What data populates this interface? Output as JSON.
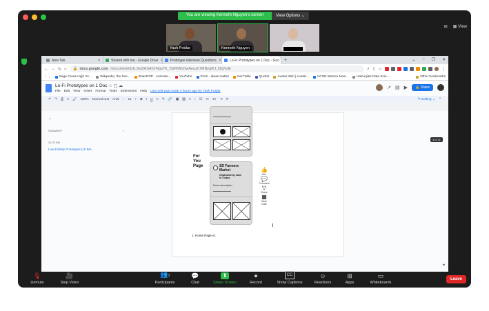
{
  "zoom": {
    "banner": "You are viewing Kenneth Nguyen's screen",
    "view_options": "View Options ⌄",
    "view_label": "View",
    "participants": [
      {
        "name": "Yash Potdar"
      },
      {
        "name": "Kenneth Nguyen"
      },
      {
        "name": ""
      }
    ],
    "controls": [
      {
        "icon": "mic-muted-icon",
        "glyph": "🎙",
        "label": "Unmute"
      },
      {
        "icon": "video-icon",
        "glyph": "🎥",
        "label": "Stop Video"
      },
      {
        "icon": "participants-icon",
        "glyph": "👥",
        "label": "Participants",
        "count": "3"
      },
      {
        "icon": "chat-icon",
        "glyph": "💬",
        "label": "Chat"
      },
      {
        "icon": "share-screen-icon",
        "glyph": "⬆",
        "label": "Share Screen"
      },
      {
        "icon": "record-icon",
        "glyph": "⏺",
        "label": "Record"
      },
      {
        "icon": "captions-icon",
        "glyph": "CC",
        "label": "Show Captions"
      },
      {
        "icon": "reactions-icon",
        "glyph": "☺",
        "label": "Reactions"
      },
      {
        "icon": "apps-icon",
        "glyph": "⊞",
        "label": "Apps"
      },
      {
        "icon": "whiteboards-icon",
        "glyph": "▭",
        "label": "Whiteboards"
      }
    ],
    "leave": "Leave"
  },
  "browser": {
    "tabs": [
      {
        "title": "New Tab",
        "color": "#888888"
      },
      {
        "title": "Shared with me - Google Drive",
        "color": "#34a853"
      },
      {
        "title": "Prototype Interview Questions",
        "color": "#4285f4"
      },
      {
        "title": "Lo-Fi Prototypes on 1 Doc - Goo",
        "color": "#4285f4"
      }
    ],
    "url_host": "docs.google.com",
    "url_path": "/document/d/1L9xiZHSAh7Hpp7K_5SPjlNVhwAeuzh7MNzqRJ_NQ/edit",
    "bookmarks": [
      {
        "label": "Sage Creek High Sc...",
        "color": "#1a73e8"
      },
      {
        "label": "Wikipedia, the free...",
        "color": "#888888"
      },
      {
        "label": "BrainPOP - Animate...",
        "color": "#f28b00"
      },
      {
        "label": "YouTube",
        "color": "#e02828"
      },
      {
        "label": "Prezi - ideas matter",
        "color": "#3367d6"
      },
      {
        "label": "Nerf Wiki",
        "color": "#f28b00"
      },
      {
        "label": "Quizlet",
        "color": "#4257b2"
      },
      {
        "label": "Avatar Wiki | Avatar...",
        "color": "#c9a227"
      },
      {
        "label": "UCSD Warren New...",
        "color": "#1a73e8"
      },
      {
        "label": "Halcorji&s Data Scie...",
        "color": "#888888"
      }
    ],
    "other_bookmarks": "Other bookmarks"
  },
  "doc": {
    "title": "Lo-Fi Prototypes on 1 Doc",
    "menus": [
      "File",
      "Edit",
      "View",
      "Insert",
      "Format",
      "Tools",
      "Extensions",
      "Help"
    ],
    "last_edit": "Last edit was made 4 hours ago by Yash Potdar",
    "share": "Share",
    "toolbar": {
      "zoom": "100%",
      "style": "Normal text",
      "font": "Arial",
      "size": "11",
      "editing": "Editing"
    },
    "outline": {
      "summary": "SUMMARY",
      "outline": "OUTLINE",
      "item": "Low-Fidelity Prototypes (10 bet..."
    },
    "page_indicator": "3 of 11",
    "for_you": "For You Page",
    "card": {
      "title": "SD Farmers Market",
      "organizer": "Organized by Jane",
      "when": "In 4 days",
      "description": "Event description"
    },
    "actions": [
      "Like",
      "Comment",
      "Share",
      "Save Date"
    ],
    "caption": "1: Home Page v1"
  }
}
